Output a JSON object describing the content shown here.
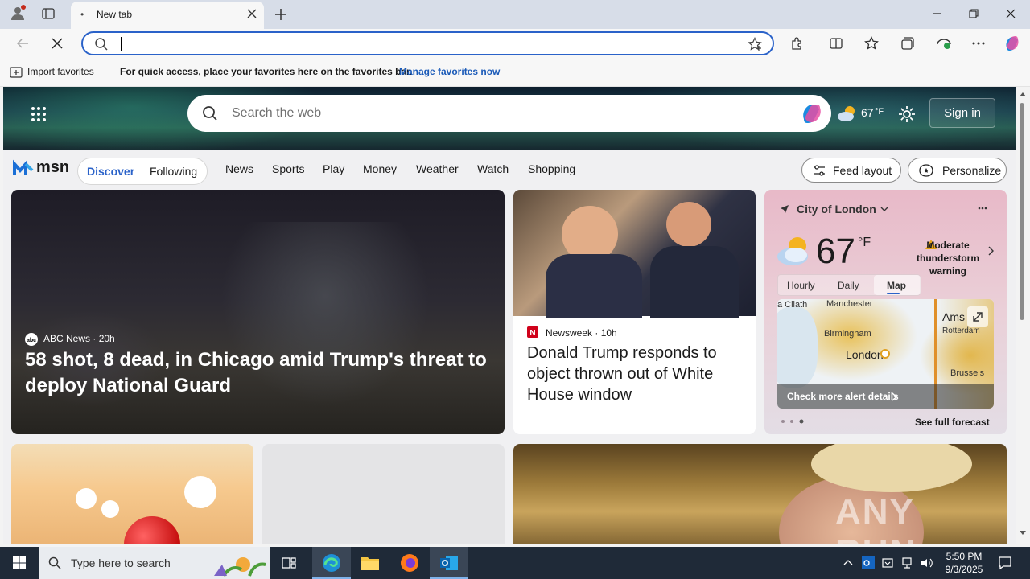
{
  "browser": {
    "tab_title": "New tab",
    "address_value": "",
    "favorites_import": "Import favorites",
    "favorites_message": "For quick access, place your favorites here on the favorites bar.",
    "favorites_manage": "Manage favorites now"
  },
  "msn": {
    "logo": "msn",
    "search_placeholder": "Search the web",
    "temperature_mini": "67",
    "temp_unit_mini": "°F",
    "signin": "Sign in",
    "nav_pill": {
      "discover": "Discover",
      "following": "Following"
    },
    "nav": [
      "News",
      "Sports",
      "Play",
      "Money",
      "Weather",
      "Watch",
      "Shopping"
    ],
    "feed_layout": "Feed layout",
    "personalize": "Personalize"
  },
  "cards": {
    "main": {
      "source": "ABC News",
      "age": "20h",
      "title": "58 shot, 8 dead, in Chicago amid Trump's threat to deploy National Guard"
    },
    "side": {
      "source": "Newsweek",
      "age": "10h",
      "title": "Donald Trump responds to object thrown out of White House window"
    }
  },
  "weather": {
    "location": "City of London",
    "temperature": "67",
    "unit": "°F",
    "alert": "Moderate thunderstorm warning",
    "tabs": [
      "Hourly",
      "Daily",
      "Map"
    ],
    "active_tab": "Map",
    "map_labels": [
      "a Cliath",
      "Manchester",
      "Birmingham",
      "London",
      "Ams",
      "Rotterdam",
      "Brussels"
    ],
    "alert_link": "Check more alert details",
    "forecast": "See full forecast"
  },
  "taskbar": {
    "search": "Type here to search",
    "time": "5:50 PM",
    "date": "9/3/2025"
  },
  "watermark": "ANY RUN"
}
